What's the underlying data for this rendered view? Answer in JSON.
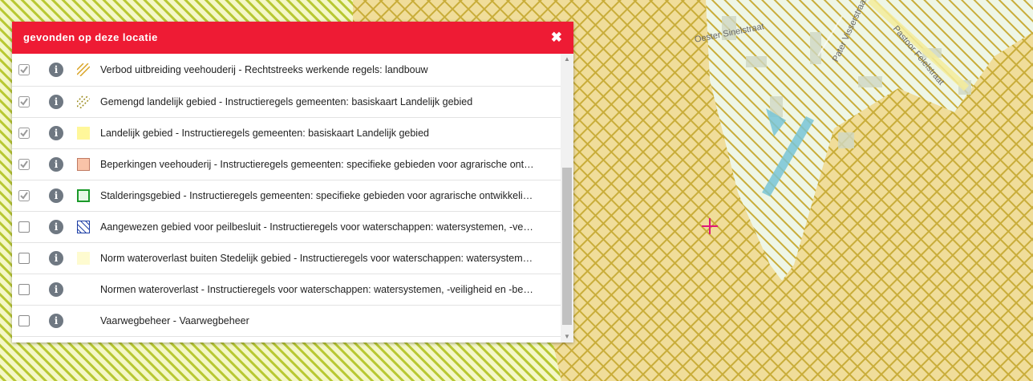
{
  "panel": {
    "title": "gevonden op deze locatie",
    "close_label": "✖",
    "items": [
      {
        "label": "Verbod uitbreiding veehouderij - Rechtstreeks werkende regels: landbouw",
        "checked": true,
        "legend": "hatch-orange"
      },
      {
        "label": "Gemengd landelijk gebied - Instructieregels gemeenten: basiskaart Landelijk gebied",
        "checked": true,
        "legend": "hatch-olive"
      },
      {
        "label": "Landelijk gebied - Instructieregels gemeenten: basiskaart Landelijk gebied",
        "checked": true,
        "legend": "fill-yellow"
      },
      {
        "label": "Beperkingen veehouderij - Instructieregels gemeenten: specifieke gebieden voor agrarische ont…",
        "checked": true,
        "legend": "fill-salmon"
      },
      {
        "label": "Stalderingsgebied - Instructieregels gemeenten: specifieke gebieden voor agrarische ontwikkeli…",
        "checked": true,
        "legend": "outline-green"
      },
      {
        "label": "Aangewezen gebied voor peilbesluit - Instructieregels voor waterschappen: watersystemen, -ve…",
        "checked": false,
        "legend": "hatch-blue"
      },
      {
        "label": "Norm wateroverlast buiten Stedelijk gebied - Instructieregels voor waterschappen: watersystem…",
        "checked": false,
        "legend": "fill-paleyellow"
      },
      {
        "label": "Normen wateroverlast - Instructieregels voor waterschappen: watersystemen, -veiligheid en -be…",
        "checked": false,
        "legend": "none"
      },
      {
        "label": "Vaarwegbeheer - Vaarwegbeheer",
        "checked": false,
        "legend": "none"
      }
    ]
  },
  "map": {
    "streets": [
      "Oester Sinelstraat",
      "Pater Visserstraat",
      "Pastoor Felelstraat"
    ],
    "colors": {
      "accent": "#ee1b34",
      "crosshatch": "#c9ad3a",
      "yellow_green_hatch": "#b8c832",
      "marker": "#e0177a"
    }
  }
}
